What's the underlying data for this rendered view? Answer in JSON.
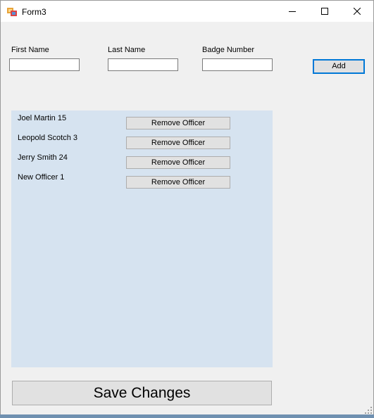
{
  "window": {
    "title": "Form3"
  },
  "form": {
    "first_name_label": "First Name",
    "last_name_label": "Last Name",
    "badge_number_label": "Badge Number",
    "first_name_value": "",
    "last_name_value": "",
    "badge_number_value": "",
    "add_label": "Add"
  },
  "officers": [
    {
      "name": "Joel Martin 15",
      "remove_label": "Remove Officer"
    },
    {
      "name": "Leopold Scotch 3",
      "remove_label": "Remove Officer"
    },
    {
      "name": "Jerry Smith 24",
      "remove_label": "Remove Officer"
    },
    {
      "name": "New Officer 1",
      "remove_label": "Remove Officer"
    }
  ],
  "save_label": "Save Changes",
  "colors": {
    "panel": "#d6e3f0",
    "accent": "#0078d7",
    "button": "#e1e1e1"
  },
  "icons": [
    "app-icon",
    "minimize-icon",
    "maximize-icon",
    "close-icon",
    "resize-grip-icon"
  ]
}
